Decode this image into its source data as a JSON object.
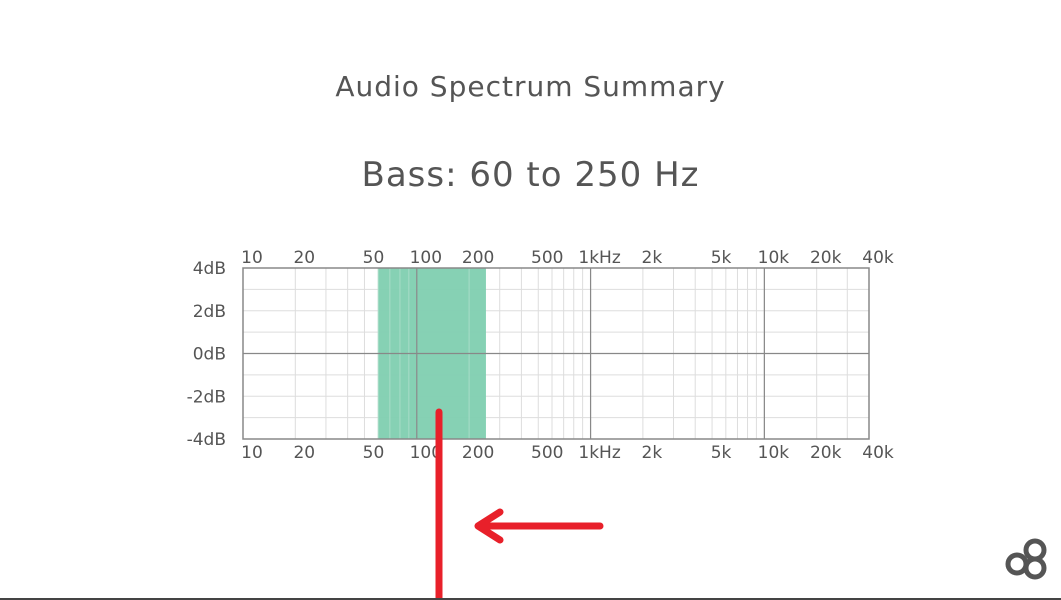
{
  "header": {
    "title": "Audio Spectrum Summary",
    "subtitle": "Bass: 60 to 250 Hz"
  },
  "chart_data": {
    "type": "area",
    "x_scale": "log",
    "xlim": [
      10,
      40000
    ],
    "ylim": [
      -4,
      4
    ],
    "x_ticks": [
      {
        "value": 10,
        "label": "10"
      },
      {
        "value": 20,
        "label": "20"
      },
      {
        "value": 50,
        "label": "50"
      },
      {
        "value": 100,
        "label": "100"
      },
      {
        "value": 200,
        "label": "200"
      },
      {
        "value": 500,
        "label": "500"
      },
      {
        "value": 1000,
        "label": "1kHz"
      },
      {
        "value": 2000,
        "label": "2k"
      },
      {
        "value": 5000,
        "label": "5k"
      },
      {
        "value": 10000,
        "label": "10k"
      },
      {
        "value": 20000,
        "label": "20k"
      },
      {
        "value": 40000,
        "label": "40k"
      }
    ],
    "y_ticks": [
      {
        "value": 4,
        "label": "4dB"
      },
      {
        "value": 2,
        "label": "2dB"
      },
      {
        "value": 0,
        "label": "0dB"
      },
      {
        "value": -2,
        "label": "-2dB"
      },
      {
        "value": -4,
        "label": "-4dB"
      }
    ],
    "highlight_band": {
      "from": 60,
      "to": 250,
      "color": "#7fcfb0"
    },
    "grid": true,
    "grid_color": "#dddddd",
    "decade_line_color": "#888888"
  },
  "annotation": {
    "type": "arrow",
    "color": "#e8202a"
  },
  "logo": {
    "icon": "brand-logo-icon",
    "color": "#555555"
  }
}
